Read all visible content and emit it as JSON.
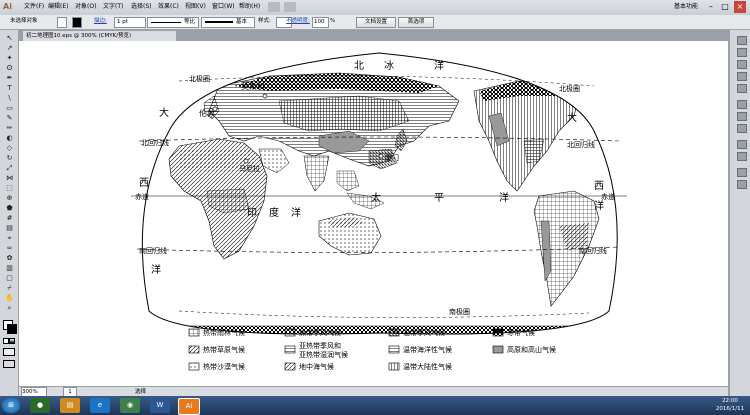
{
  "app": {
    "icon": "Ai"
  },
  "menu": [
    "文件(F)",
    "编辑(E)",
    "对象(O)",
    "文字(T)",
    "选择(S)",
    "效果(C)",
    "视图(V)",
    "窗口(W)",
    "帮助(H)"
  ],
  "workspace_label": "基本功能",
  "control_bar": {
    "no_selection": "未选择对象",
    "stroke_label": "描边:",
    "stroke_value": "1 pt",
    "profile_label": "等比",
    "brush_label": "基本",
    "style_label": "样式:",
    "opacity_label": "不透明度:",
    "opacity_value": "100",
    "opacity_unit": "%",
    "doc_setup_button": "文档设置",
    "prefs_button": "首选项"
  },
  "document_tab": "初二地理图10.eps @ 300% (CMYK/预览)",
  "status": {
    "zoom": "300%",
    "page": "1",
    "mode": "选择"
  },
  "map": {
    "labels": {
      "arctic1": "北",
      "arctic2": "冰",
      "arctic3": "洋",
      "arctic_circle_l": "北极圈",
      "arctic_circle_r": "北极圈",
      "moscow": "莫斯科",
      "london": "伦敦",
      "xiamen": "厦门",
      "manila": "马尼拉",
      "atl_n1": "大",
      "atl_w1": "西",
      "atl_w2": "洋",
      "pac1": "太",
      "pac2": "平",
      "pac3": "洋",
      "pac_e1": "大",
      "pac_e2": "西",
      "pac_e3": "洋",
      "indian1": "印",
      "indian2": "度",
      "indian3": "洋",
      "tropic_n_l": "北回归线",
      "tropic_n_r": "北回归线",
      "equator_l": "赤道",
      "equator_r": "赤道",
      "tropic_s_l": "南回归线",
      "tropic_s_r": "南回归线",
      "antarctic": "南极圈"
    }
  },
  "legend": [
    {
      "label": "热带雨林气候",
      "pattern": "grid"
    },
    {
      "label": "热带季风气候",
      "pattern": "grid"
    },
    {
      "label": "温带季风气候",
      "pattern": "dense"
    },
    {
      "label": "寒带气候",
      "pattern": "checker"
    },
    {
      "label": "热带草原气候",
      "pattern": "diag"
    },
    {
      "label": "亚热带季风和\n亚热带湿润气候",
      "pattern": "hlines"
    },
    {
      "label": "温带海洋性气候",
      "pattern": "hlines"
    },
    {
      "label": "高原和高山气候",
      "pattern": "gray"
    },
    {
      "label": "热带沙漠气候",
      "pattern": "dots"
    },
    {
      "label": "地中海气候",
      "pattern": "diag"
    },
    {
      "label": "温带大陆性气候",
      "pattern": "vlines"
    }
  ],
  "clock": {
    "time": "22:00",
    "date": "2016/1/11"
  },
  "colors": {
    "menubar": "#dfe3e8",
    "taskbar": "#1d3558",
    "ai_orange": "#e87a1e"
  }
}
